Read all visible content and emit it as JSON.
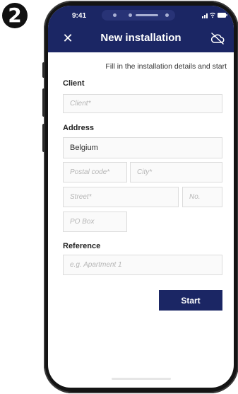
{
  "step_number": "2",
  "status_bar": {
    "time": "9:41",
    "icons": [
      "signal-icon",
      "wifi-icon",
      "battery-icon"
    ]
  },
  "nav": {
    "close_icon": "close-icon",
    "close_glyph": "✕",
    "title": "New installation",
    "offline_icon": "cloud-off-icon"
  },
  "intro": "Fill in the installation details and start",
  "client": {
    "label": "Client",
    "placeholder": "Client*",
    "value": ""
  },
  "address": {
    "label": "Address",
    "country": "Belgium",
    "postal_code_placeholder": "Postal code*",
    "city_placeholder": "City*",
    "street_placeholder": "Street*",
    "number_placeholder": "No.",
    "po_box_placeholder": "PO Box"
  },
  "reference": {
    "label": "Reference",
    "placeholder": "e.g. Apartment 1"
  },
  "start_label": "Start",
  "colors": {
    "primary": "#1b2664",
    "field_border": "#dcdcdc",
    "placeholder": "#b5b5b5",
    "phone_frame": "#141414"
  }
}
